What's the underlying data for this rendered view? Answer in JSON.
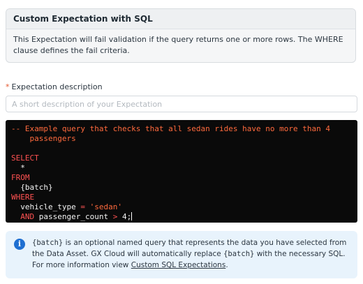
{
  "card": {
    "title": "Custom Expectation with SQL",
    "body": "This Expectation will fail validation if the query returns one or more rows. The WHERE clause defines the fail criteria."
  },
  "description_field": {
    "required_mark": "*",
    "label": "Expectation description",
    "value": "",
    "placeholder": "A short description of your Expectation"
  },
  "editor": {
    "comment_1": "-- Example query that checks that all sedan rides have no more than 4",
    "comment_2": "    passengers",
    "kw_select": "SELECT",
    "star": "*",
    "kw_from": "FROM",
    "batch": "{batch}",
    "kw_where": "WHERE",
    "col_1": "vehicle_type",
    "eq": "=",
    "str_val": "'sedan'",
    "kw_and": "AND",
    "col_2": "passenger_count",
    "gt": ">",
    "num": "4",
    "semi": ";"
  },
  "info": {
    "icon": "info-icon",
    "code_batch": "{batch}",
    "text_1": " is an optional named query that represents the data you have selected from the Data Asset. GX Cloud will automatically replace ",
    "code_batch_2": "{batch}",
    "text_2": " with the necessary SQL. For more information view ",
    "link": "Custom SQL Expectations",
    "text_3": "."
  },
  "colors": {
    "editor_bg": "#0a0a0a",
    "keyword": "#ff5252",
    "comment": "#ff6a3d",
    "info_bg": "#e8f3fc",
    "info_icon": "#1f6fd1",
    "required": "#e4572e"
  }
}
